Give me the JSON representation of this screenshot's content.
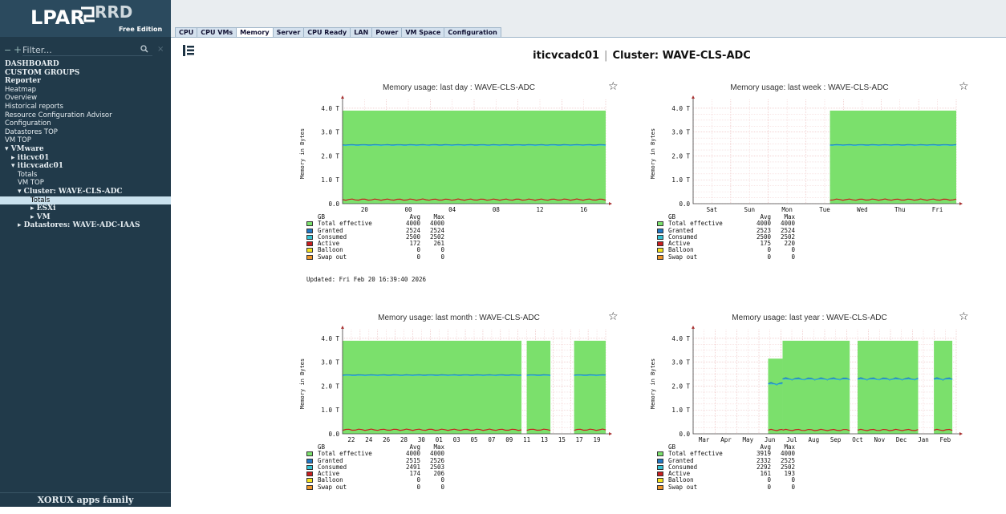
{
  "app": {
    "logo_main": "LPAR",
    "logo_rrd": "RRD",
    "logo_edition": "Free Edition"
  },
  "filter": {
    "placeholder": "Filter..."
  },
  "nav": [
    {
      "label": "DASHBOARD",
      "style": "bold",
      "level": 0
    },
    {
      "label": "CUSTOM GROUPS",
      "style": "bold",
      "level": 0
    },
    {
      "label": "Reporter",
      "style": "bold",
      "level": 0
    },
    {
      "label": "Heatmap",
      "style": "",
      "level": 0
    },
    {
      "label": "Overview",
      "style": "",
      "level": 0
    },
    {
      "label": "Historical reports",
      "style": "",
      "level": 0
    },
    {
      "label": "Resource Configuration Advisor",
      "style": "",
      "level": 0
    },
    {
      "label": "Configuration",
      "style": "",
      "level": 0
    },
    {
      "label": "Datastores TOP",
      "style": "",
      "level": 0
    },
    {
      "label": "VM TOP",
      "style": "",
      "level": 0
    },
    {
      "label": "▾ VMware",
      "style": "bold",
      "level": 0
    },
    {
      "label": "▸ iticvc01",
      "style": "bold",
      "level": 1
    },
    {
      "label": "▾ iticvcadc01",
      "style": "bold",
      "level": 1
    },
    {
      "label": "Totals",
      "style": "",
      "level": 2
    },
    {
      "label": "VM TOP",
      "style": "",
      "level": 2
    },
    {
      "label": "▾ Cluster: WAVE-CLS-ADC",
      "style": "bold",
      "level": 2
    },
    {
      "label": "Totals",
      "style": "",
      "level": 3,
      "selected": true
    },
    {
      "label": "▸ ESXi",
      "style": "bold",
      "level": 4
    },
    {
      "label": "▸ VM",
      "style": "bold",
      "level": 4
    },
    {
      "label": "▸ Datastores: WAVE-ADC-IAAS",
      "style": "bold",
      "level": 2
    }
  ],
  "footer": "XORUX apps family",
  "tabs": [
    "CPU",
    "CPU VMs",
    "Memory",
    "Server",
    "CPU Ready",
    "LAN",
    "Power",
    "VM Space",
    "Configuration"
  ],
  "active_tab": "Memory",
  "heading": {
    "host": "iticvcadc01",
    "separator": "|",
    "cluster": "Cluster: WAVE-CLS-ADC"
  },
  "icons": {
    "control": "list-toggle-icon",
    "favorite": "star-icon",
    "search": "search-icon"
  },
  "colors": {
    "total_effective": "#7be06c",
    "granted": "#1f78c8",
    "consumed": "#35c4d6",
    "active": "#c81e1e",
    "balloon": "#f5e31e",
    "swap_out": "#f0962a"
  },
  "legend_header": {
    "unit": "GB",
    "avg": "Avg",
    "max": "Max"
  },
  "legend_labels": [
    "Total effective",
    "Granted",
    "Consumed",
    "Active",
    "Balloon",
    "Swap out"
  ],
  "legend_keys": [
    "total_effective",
    "granted",
    "consumed",
    "active",
    "balloon",
    "swap_out"
  ],
  "updated": "Updated: Fri Feb 20 16:39:40 2026",
  "chart_data": [
    {
      "type": "area",
      "title": "Memory usage: last day : WAVE-CLS-ADC",
      "ylabel": "Memory in Bytes",
      "yticks": [
        "4.0 T",
        "3.0 T",
        "2.0 T",
        "1.0 T",
        "0.0"
      ],
      "ylim": [
        0,
        4.2
      ],
      "xticks": [
        "20",
        "00",
        "04",
        "08",
        "12",
        "16"
      ],
      "segments": [
        [
          0.0,
          1.0
        ]
      ],
      "series": [
        {
          "name": "Total effective",
          "avg": "4000",
          "max": "4000",
          "level": 3.9
        },
        {
          "name": "Granted",
          "avg": "2524",
          "max": "2524",
          "level": 2.46
        },
        {
          "name": "Consumed",
          "avg": "2500",
          "max": "2502",
          "level": 2.44
        },
        {
          "name": "Active",
          "avg": "172",
          "max": "261",
          "level": 0.17
        },
        {
          "name": "Balloon",
          "avg": "0",
          "max": "0",
          "level": 0
        },
        {
          "name": "Swap out",
          "avg": "0",
          "max": "0",
          "level": 0
        }
      ],
      "grid": true
    },
    {
      "type": "area",
      "title": "Memory usage: last week : WAVE-CLS-ADC",
      "ylabel": "Memory in Bytes",
      "yticks": [
        "4.0 T",
        "3.0 T",
        "2.0 T",
        "1.0 T",
        "0.0"
      ],
      "ylim": [
        0,
        4.2
      ],
      "xticks": [
        "Sat",
        "Sun",
        "Mon",
        "Tue",
        "Wed",
        "Thu",
        "Fri"
      ],
      "segments": [
        [
          0.52,
          1.0
        ]
      ],
      "series": [
        {
          "name": "Total effective",
          "avg": "4000",
          "max": "4000",
          "level": 3.9
        },
        {
          "name": "Granted",
          "avg": "2523",
          "max": "2524",
          "level": 2.46
        },
        {
          "name": "Consumed",
          "avg": "2500",
          "max": "2502",
          "level": 2.44
        },
        {
          "name": "Active",
          "avg": "175",
          "max": "220",
          "level": 0.17
        },
        {
          "name": "Balloon",
          "avg": "0",
          "max": "0",
          "level": 0
        },
        {
          "name": "Swap out",
          "avg": "0",
          "max": "0",
          "level": 0
        }
      ],
      "grid": true
    },
    {
      "type": "area",
      "title": "Memory usage: last month : WAVE-CLS-ADC",
      "ylabel": "Memory in Bytes",
      "yticks": [
        "4.0 T",
        "3.0 T",
        "2.0 T",
        "1.0 T",
        "0.0"
      ],
      "ylim": [
        0,
        4.2
      ],
      "xticks": [
        "22",
        "24",
        "26",
        "28",
        "30",
        "01",
        "03",
        "05",
        "07",
        "09",
        "11",
        "13",
        "15",
        "17",
        "19"
      ],
      "segments": [
        [
          0.0,
          0.68
        ],
        [
          0.7,
          0.79
        ],
        [
          0.88,
          1.0
        ]
      ],
      "series": [
        {
          "name": "Total effective",
          "avg": "4000",
          "max": "4000",
          "level": 3.9
        },
        {
          "name": "Granted",
          "avg": "2515",
          "max": "2526",
          "level": 2.46
        },
        {
          "name": "Consumed",
          "avg": "2491",
          "max": "2503",
          "level": 2.44
        },
        {
          "name": "Active",
          "avg": "174",
          "max": "206",
          "level": 0.17
        },
        {
          "name": "Balloon",
          "avg": "0",
          "max": "0",
          "level": 0
        },
        {
          "name": "Swap out",
          "avg": "0",
          "max": "0",
          "level": 0
        }
      ],
      "grid": true
    },
    {
      "type": "area",
      "title": "Memory usage: last year : WAVE-CLS-ADC",
      "ylabel": "Memory in Bytes",
      "yticks": [
        "4.0 T",
        "3.0 T",
        "2.0 T",
        "1.0 T",
        "0.0"
      ],
      "ylim": [
        0,
        4.2
      ],
      "xticks": [
        "Mar",
        "Apr",
        "May",
        "Jun",
        "Jul",
        "Aug",
        "Sep",
        "Oct",
        "Nov",
        "Dec",
        "Jan",
        "Feb"
      ],
      "segments": [
        [
          0.285,
          0.34,
          3.15
        ],
        [
          0.34,
          0.595,
          3.9
        ],
        [
          0.625,
          0.855,
          3.9
        ],
        [
          0.915,
          0.985,
          3.9
        ]
      ],
      "series": [
        {
          "name": "Total effective",
          "avg": "3919",
          "max": "4000",
          "level": 3.9
        },
        {
          "name": "Granted",
          "avg": "2332",
          "max": "2525",
          "level": 2.3
        },
        {
          "name": "Consumed",
          "avg": "2292",
          "max": "2502",
          "level": 2.28
        },
        {
          "name": "Active",
          "avg": "161",
          "max": "193",
          "level": 0.16
        },
        {
          "name": "Balloon",
          "avg": "0",
          "max": "0",
          "level": 0
        },
        {
          "name": "Swap out",
          "avg": "0",
          "max": "0",
          "level": 0
        }
      ],
      "grid": true
    }
  ]
}
